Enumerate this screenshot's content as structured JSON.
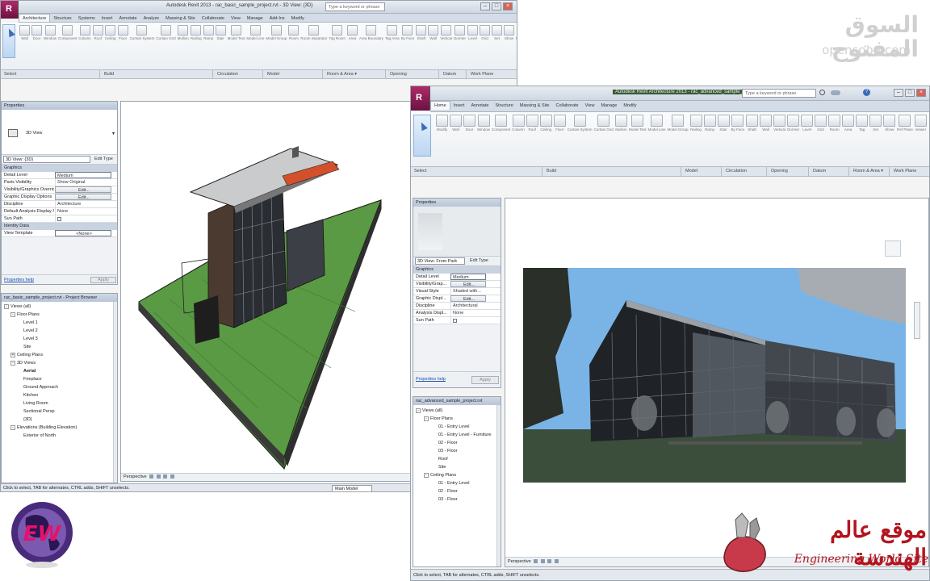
{
  "watermark": {
    "arabic": "السوق المفتوح",
    "latin": "opensooq.com"
  },
  "brand": {
    "ew_letters": "EW",
    "eng_arabic": "موقع عالم الهندسة",
    "eng_latin": "Engineering World Site"
  },
  "win1": {
    "title": "Autodesk Revit 2013 -   rac_basic_sample_project.rvt - 3D View: {3D}",
    "search_placeholder": "Type a keyword or phrase",
    "tabs": [
      "Architecture",
      "Structure",
      "Systems",
      "Insert",
      "Annotate",
      "Analyze",
      "Massing & Site",
      "Collaborate",
      "View",
      "Manage",
      "Add-Ins",
      "Modify"
    ],
    "ribbon_labels": [
      "Wall",
      "Door",
      "Window",
      "Component",
      "Column",
      "Roof",
      "Ceiling",
      "Floor",
      "Curtain System",
      "Curtain Grid",
      "Mullion",
      "Railing",
      "Ramp",
      "Stair",
      "Model Text",
      "Model Line",
      "Model Group",
      "Room",
      "Room Separator",
      "Tag Room",
      "Area",
      "Area Boundary",
      "Tag Area",
      "By Face",
      "Shaft",
      "Wall",
      "Vertical",
      "Dormer",
      "Level",
      "Grid",
      "Set",
      "Show",
      "Ref Plane",
      "Viewer"
    ],
    "panels": [
      "Select",
      "Build",
      "Circulation",
      "Model",
      "Room & Area ▾",
      "Opening",
      "Datum",
      "Work Plane"
    ],
    "properties": {
      "header": "Properties",
      "type_name": "3D View",
      "selector": "3D View: {3D}",
      "edit_type": "Edit Type",
      "group_graphics": "Graphics",
      "rows": [
        {
          "name": "Detail Level",
          "value": "Medium"
        },
        {
          "name": "Parts Visibility",
          "value": "Show Original"
        },
        {
          "name": "Visibility/Graphics Overrides",
          "value": "Edit..."
        },
        {
          "name": "Graphic Display Options",
          "value": "Edit..."
        },
        {
          "name": "Discipline",
          "value": "Architecture"
        },
        {
          "name": "Default Analysis Display Style",
          "value": "None"
        },
        {
          "name": "Sun Path",
          "value": ""
        }
      ],
      "group_identity": "Identity Data",
      "rows2": [
        {
          "name": "View Template",
          "value": "<None>"
        }
      ],
      "help_link": "Properties help",
      "apply": "Apply"
    },
    "browser": {
      "header": "rac_basic_sample_project.rvt - Project Browser",
      "items": [
        {
          "label": "Views (all)",
          "indent": 0,
          "toggle": "-"
        },
        {
          "label": "Floor Plans",
          "indent": 1,
          "toggle": "-"
        },
        {
          "label": "Level 1",
          "indent": 2,
          "toggle": ""
        },
        {
          "label": "Level 2",
          "indent": 2,
          "toggle": ""
        },
        {
          "label": "Level 3",
          "indent": 2,
          "toggle": ""
        },
        {
          "label": "Site",
          "indent": 2,
          "toggle": ""
        },
        {
          "label": "Ceiling Plans",
          "indent": 1,
          "toggle": "+"
        },
        {
          "label": "3D Views",
          "indent": 1,
          "toggle": "-"
        },
        {
          "label": "Aerial",
          "indent": 2,
          "toggle": "",
          "bold": true
        },
        {
          "label": "Fireplace",
          "indent": 2,
          "toggle": ""
        },
        {
          "label": "Ground Approach",
          "indent": 2,
          "toggle": ""
        },
        {
          "label": "Kitchen",
          "indent": 2,
          "toggle": ""
        },
        {
          "label": "Living Room",
          "indent": 2,
          "toggle": ""
        },
        {
          "label": "Sectional Persp",
          "indent": 2,
          "toggle": ""
        },
        {
          "label": "{3D}",
          "indent": 2,
          "toggle": ""
        },
        {
          "label": "Elevations (Building Elevation)",
          "indent": 1,
          "toggle": "-"
        },
        {
          "label": "Exterior of North",
          "indent": 2,
          "toggle": ""
        }
      ]
    },
    "viewbar": "Perspective",
    "status": "Click to select, TAB for alternates, CTRL adds, SHIFT unselects.",
    "model_label": "Main Model"
  },
  "win2": {
    "title": "Autodesk Revit Architecture 2013 -   rac_advanced_sample_project.rvt",
    "search_placeholder": "Type a keyword or phrase",
    "tabs": [
      "Home",
      "Insert",
      "Annotate",
      "Structure",
      "Massing & Site",
      "Collaborate",
      "View",
      "Manage",
      "Modify"
    ],
    "ribbon_labels": [
      "Modify",
      "Wall",
      "Door",
      "Window",
      "Component",
      "Column",
      "Roof",
      "Ceiling",
      "Floor",
      "Curtain System",
      "Curtain Grid",
      "Mullion",
      "Model Text",
      "Model Line",
      "Model Group",
      "Railing",
      "Ramp",
      "Stair",
      "By Face",
      "Shaft",
      "Wall",
      "Vertical",
      "Dormer",
      "Level",
      "Grid",
      "Room",
      "Area",
      "Tag",
      "Set",
      "Show",
      "Ref Plane",
      "Viewer"
    ],
    "panels": [
      "Select",
      "Build",
      "Model",
      "Circulation",
      "Opening",
      "Datum",
      "Room & Area ▾",
      "Work Plane"
    ],
    "properties": {
      "header": "Properties",
      "selector": "3D View: From Park",
      "edit_type": "Edit Type",
      "group_graphics": "Graphics",
      "rows": [
        {
          "name": "Detail Level",
          "value": "Medium"
        },
        {
          "name": "Visibility/Grap...",
          "value": "Edit..."
        },
        {
          "name": "Visual Style",
          "value": "Shaded with..."
        },
        {
          "name": "Graphic Displ...",
          "value": "Edit..."
        },
        {
          "name": "Discipline",
          "value": "Architectural"
        },
        {
          "name": "Analysis Displ...",
          "value": "None"
        },
        {
          "name": "Sun Path",
          "value": ""
        }
      ],
      "help_link": "Properties help",
      "apply": "Apply"
    },
    "browser": {
      "header": "rac_advanced_sample_project.rvt",
      "items": [
        {
          "label": "Views (all)",
          "indent": 0,
          "toggle": "-"
        },
        {
          "label": "Floor Plans",
          "indent": 1,
          "toggle": "-"
        },
        {
          "label": "01 - Entry Level",
          "indent": 2,
          "toggle": ""
        },
        {
          "label": "01 - Entry Level - Furniture",
          "indent": 2,
          "toggle": ""
        },
        {
          "label": "02 - Floor",
          "indent": 2,
          "toggle": ""
        },
        {
          "label": "03 - Floor",
          "indent": 2,
          "toggle": ""
        },
        {
          "label": "Roof",
          "indent": 2,
          "toggle": ""
        },
        {
          "label": "Site",
          "indent": 2,
          "toggle": ""
        },
        {
          "label": "Ceiling Plans",
          "indent": 1,
          "toggle": "-"
        },
        {
          "label": "01 - Entry Level",
          "indent": 2,
          "toggle": ""
        },
        {
          "label": "02 - Floor",
          "indent": 2,
          "toggle": ""
        },
        {
          "label": "03 - Floor",
          "indent": 2,
          "toggle": ""
        }
      ]
    },
    "viewbar": "Perspective",
    "status": "Click to select, TAB for alternates, CTRL adds, SHIFT unselects."
  },
  "colors": {
    "grass": "#4f8a3a",
    "sky": "#7ab4e6",
    "roof_accent": "#d4502a",
    "brand_red": "#b3151f",
    "brand_purple": "#4a2a7a"
  },
  "icons": [
    "modify-arrow-icon",
    "globe-icon",
    "cloud-icon",
    "search-icon",
    "help-icon",
    "close-icon"
  ]
}
